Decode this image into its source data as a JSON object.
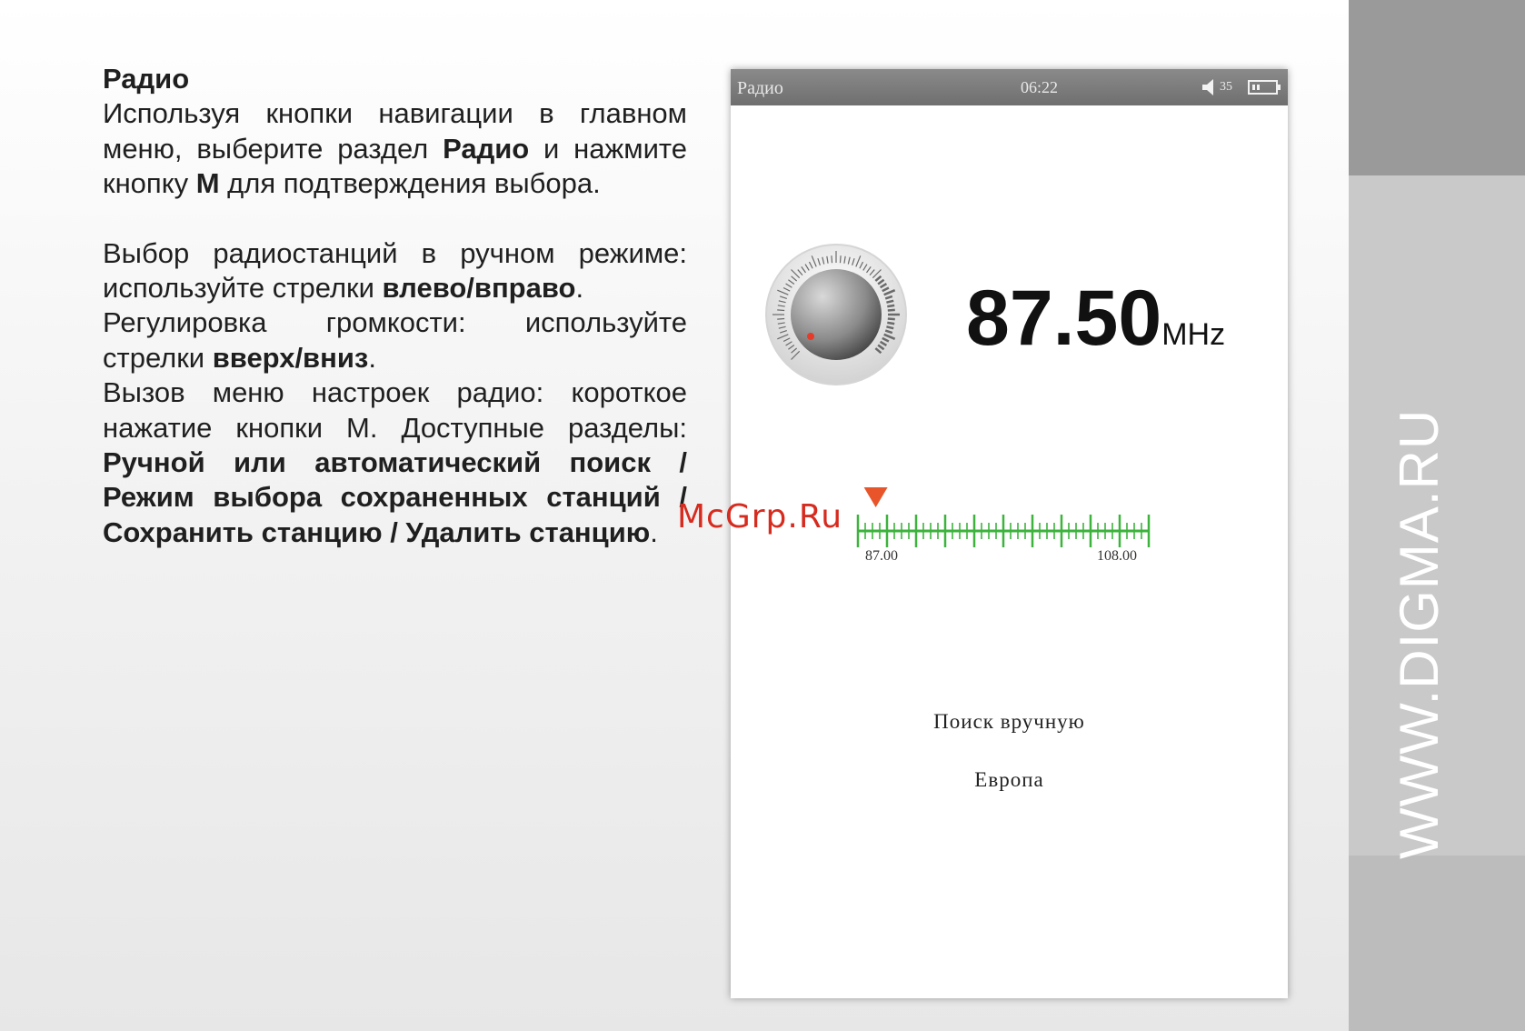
{
  "document": {
    "heading": "Радио",
    "p1": {
      "a": "Используя кнопки навигации в главном меню, выберите раздел ",
      "b": "Радио",
      "c": " и нажмите кнопку ",
      "d": "М",
      "e": " для подтверждения выбора."
    },
    "p2": {
      "a": "Выбор радиостанций в ручном режиме: используйте стрелки ",
      "b": "влево/вправо",
      "c": "."
    },
    "p3": {
      "a": "Регулировка громкости: используйте стрелки ",
      "b": "вверх/вниз",
      "c": "."
    },
    "p4": {
      "a": "Вызов меню настроек радио: короткое нажатие кнопки М. Доступные разделы: ",
      "b": "Ручной или автоматический поиск / Режим выбора сохраненных станций / Сохранить станцию / Удалить станцию",
      "c": "."
    }
  },
  "watermark": "McGrp.Ru",
  "sidebar_text": "WWW.DIGMA.RU",
  "device": {
    "status_bar": {
      "title": "Радио",
      "time": "06:22",
      "volume_level": "35"
    },
    "frequency": "87.50",
    "frequency_unit": "MHz",
    "scale": {
      "min_label": "87.00",
      "max_label": "108.00",
      "min": 87.0,
      "max": 108.0,
      "current": 87.5,
      "major_ticks": 11,
      "minor_per_major": 4
    },
    "mode": "Поиск вручную",
    "region": "Европа"
  },
  "colors": {
    "scale_green": "#3db33d",
    "pointer_orange": "#e8552a",
    "knob_dot": "#e53b2a",
    "watermark_red": "#d62b1f"
  }
}
